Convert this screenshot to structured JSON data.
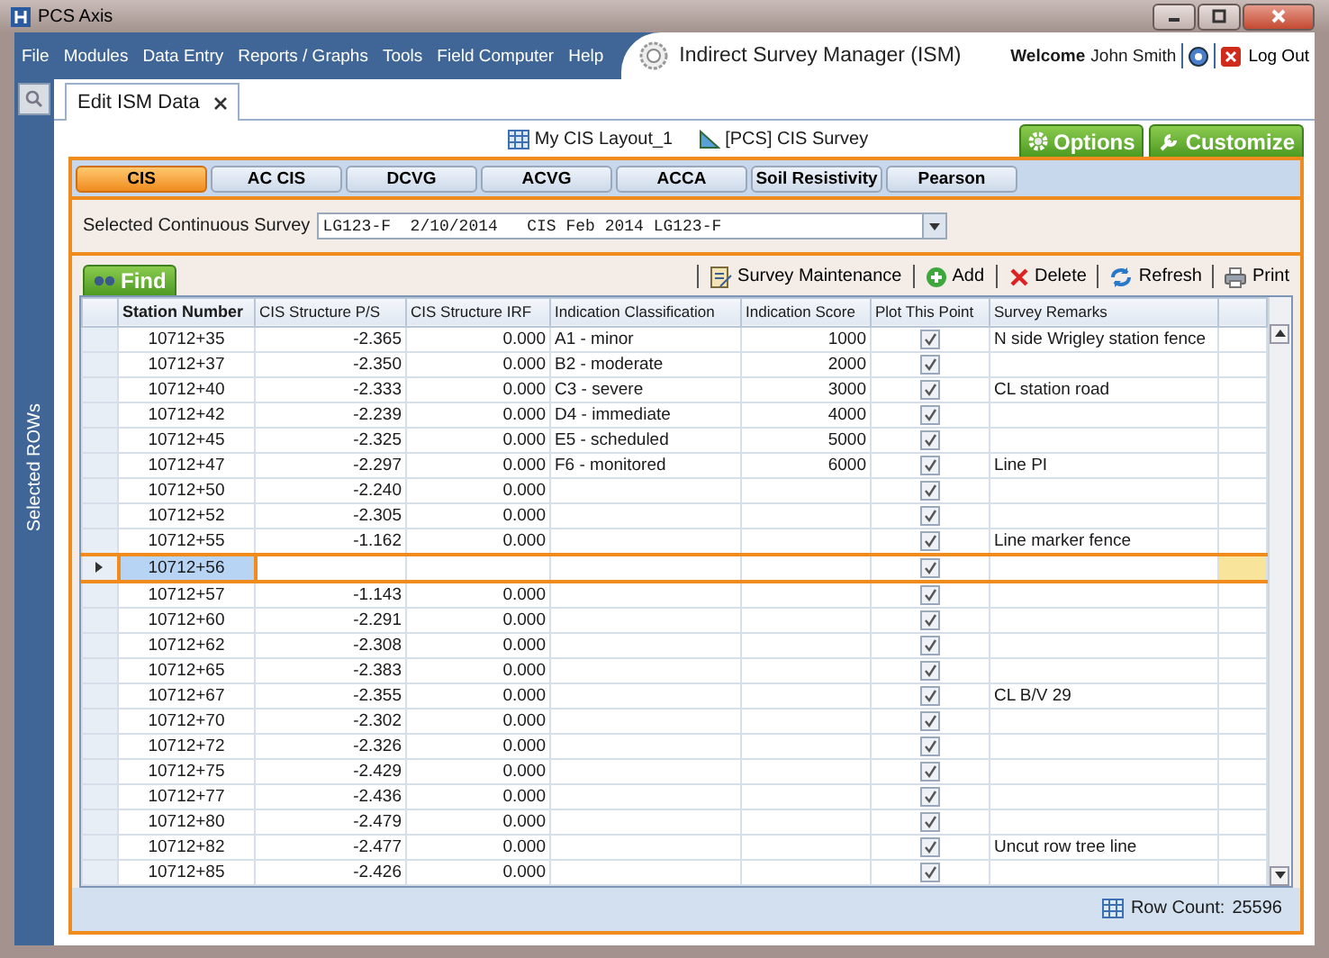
{
  "window": {
    "title": "PCS Axis"
  },
  "menu": [
    "File",
    "Modules",
    "Data Entry",
    "Reports / Graphs",
    "Tools",
    "Field Computer",
    "Help"
  ],
  "app_title": "Indirect Survey Manager (ISM)",
  "user": {
    "welcome": "Welcome",
    "name": "John Smith",
    "logout": "Log Out"
  },
  "sidebar": {
    "label": "Selected ROWs"
  },
  "doc_tabs": [
    {
      "label": "Edit ISM Data",
      "selected": true
    }
  ],
  "layout_links": [
    {
      "kind": "layout",
      "label": "My CIS Layout_1"
    },
    {
      "kind": "survey",
      "label": "[PCS] CIS Survey"
    }
  ],
  "top_buttons": [
    {
      "kind": "options",
      "label": "Options"
    },
    {
      "kind": "customize",
      "label": "Customize"
    }
  ],
  "survey_tabs": [
    {
      "label": "CIS",
      "selected": true
    },
    {
      "label": "AC CIS",
      "selected": false
    },
    {
      "label": "DCVG",
      "selected": false
    },
    {
      "label": "ACVG",
      "selected": false
    },
    {
      "label": "ACCA",
      "selected": false
    },
    {
      "label": "Soil Resistivity",
      "selected": false
    },
    {
      "label": "Pearson",
      "selected": false
    }
  ],
  "survey_select": {
    "label": "Selected Continuous Survey",
    "value": "LG123-F  2/10/2014   CIS Feb 2014 LG123-F"
  },
  "find": "Find",
  "toolbar": [
    {
      "kind": "maintenance",
      "label": "Survey Maintenance"
    },
    {
      "kind": "add",
      "label": "Add"
    },
    {
      "kind": "delete",
      "label": "Delete"
    },
    {
      "kind": "refresh",
      "label": "Refresh"
    },
    {
      "kind": "print",
      "label": "Print"
    }
  ],
  "table": {
    "columns": [
      "Station Number",
      "CIS Structure P/S",
      "CIS Structure IRF",
      "Indication Classification",
      "Indication Score",
      "Plot This Point",
      "Survey Remarks"
    ],
    "rows": [
      {
        "station": "10712+35",
        "ps": "-2.365",
        "irf": "0.000",
        "classification": "A1 - minor",
        "score": "1000",
        "plot": true,
        "remarks": "N side Wrigley station fence",
        "selected": false
      },
      {
        "station": "10712+37",
        "ps": "-2.350",
        "irf": "0.000",
        "classification": "B2 - moderate",
        "score": "2000",
        "plot": true,
        "selected": false
      },
      {
        "station": "10712+40",
        "ps": "-2.333",
        "irf": "0.000",
        "classification": "C3 - severe",
        "score": "3000",
        "plot": true,
        "remarks": "CL station road",
        "selected": false
      },
      {
        "station": "10712+42",
        "ps": "-2.239",
        "irf": "0.000",
        "classification": "D4 - immediate",
        "score": "4000",
        "plot": true,
        "selected": false
      },
      {
        "station": "10712+45",
        "ps": "-2.325",
        "irf": "0.000",
        "classification": "E5 - scheduled",
        "score": "5000",
        "plot": true,
        "selected": false
      },
      {
        "station": "10712+47",
        "ps": "-2.297",
        "irf": "0.000",
        "classification": "F6 - monitored",
        "score": "6000",
        "plot": true,
        "remarks": "Line PI",
        "selected": false
      },
      {
        "station": "10712+50",
        "ps": "-2.240",
        "irf": "0.000",
        "plot": true,
        "selected": false
      },
      {
        "station": "10712+52",
        "ps": "-2.305",
        "irf": "0.000",
        "plot": true,
        "selected": false
      },
      {
        "station": "10712+55",
        "ps": "-1.162",
        "irf": "0.000",
        "plot": true,
        "remarks": "Line marker fence",
        "selected": false
      },
      {
        "station": "10712+56",
        "plot": true,
        "selected": true
      },
      {
        "station": "10712+57",
        "ps": "-1.143",
        "irf": "0.000",
        "plot": true,
        "selected": false
      },
      {
        "station": "10712+60",
        "ps": "-2.291",
        "irf": "0.000",
        "plot": true,
        "selected": false
      },
      {
        "station": "10712+62",
        "ps": "-2.308",
        "irf": "0.000",
        "plot": true,
        "selected": false
      },
      {
        "station": "10712+65",
        "ps": "-2.383",
        "irf": "0.000",
        "plot": true,
        "selected": false
      },
      {
        "station": "10712+67",
        "ps": "-2.355",
        "irf": "0.000",
        "plot": true,
        "remarks": "CL B/V 29",
        "selected": false
      },
      {
        "station": "10712+70",
        "ps": "-2.302",
        "irf": "0.000",
        "plot": true,
        "selected": false
      },
      {
        "station": "10712+72",
        "ps": "-2.326",
        "irf": "0.000",
        "plot": true,
        "selected": false
      },
      {
        "station": "10712+75",
        "ps": "-2.429",
        "irf": "0.000",
        "plot": true,
        "selected": false
      },
      {
        "station": "10712+77",
        "ps": "-2.436",
        "irf": "0.000",
        "plot": true,
        "selected": false
      },
      {
        "station": "10712+80",
        "ps": "-2.479",
        "irf": "0.000",
        "plot": true,
        "selected": false
      },
      {
        "station": "10712+82",
        "ps": "-2.477",
        "irf": "0.000",
        "plot": true,
        "remarks": "Uncut row tree line",
        "selected": false
      },
      {
        "station": "10712+85",
        "ps": "-2.426",
        "irf": "0.000",
        "plot": true,
        "selected": false
      }
    ]
  },
  "status": {
    "label": "Row Count:",
    "value": "25596"
  }
}
